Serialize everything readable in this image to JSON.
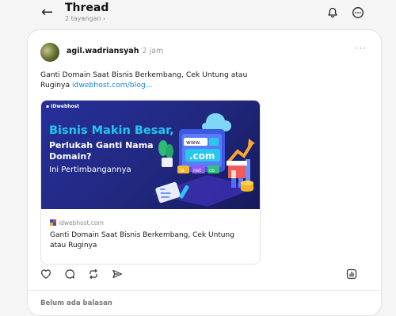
{
  "header": {
    "back_icon": "arrow-left-icon",
    "title": "Thread",
    "subtitle": "2 tayangan",
    "chevron": "›",
    "activity_icon": "bell-icon",
    "more_icon": "more-circle-icon"
  },
  "post": {
    "username": "agil.wadriansyah",
    "time": "2 jam",
    "more": "···",
    "text": "Ganti Domain Saat Bisnis Berkembang, Cek Untung atau Ruginya",
    "link": "idwebhost.com/blog...",
    "preview": {
      "banner": {
        "brand": "IDwebhost",
        "line1": "Bisnis Makin Besar,",
        "line2": "Perlukah Ganti Nama",
        "line3": "Domain?",
        "line4": "Ini Pertimbangannya",
        "browser_url": "www.",
        "tld": ".com",
        "tld_small": [
          "id",
          "net",
          "co"
        ]
      },
      "domain": "idwebhost.com",
      "title": "Ganti Domain Saat Bisnis Berkembang, Cek Untung atau Ruginya"
    },
    "actions": [
      "heart-icon",
      "comment-icon",
      "repost-icon",
      "share-icon"
    ],
    "insights_icon": "insights-icon"
  },
  "replies": {
    "empty_label": "Belum ada balasan"
  },
  "colors": {
    "link": "#0f8ad6",
    "banner_bg": "#21287e",
    "banner_accent": "#21c8f0"
  }
}
